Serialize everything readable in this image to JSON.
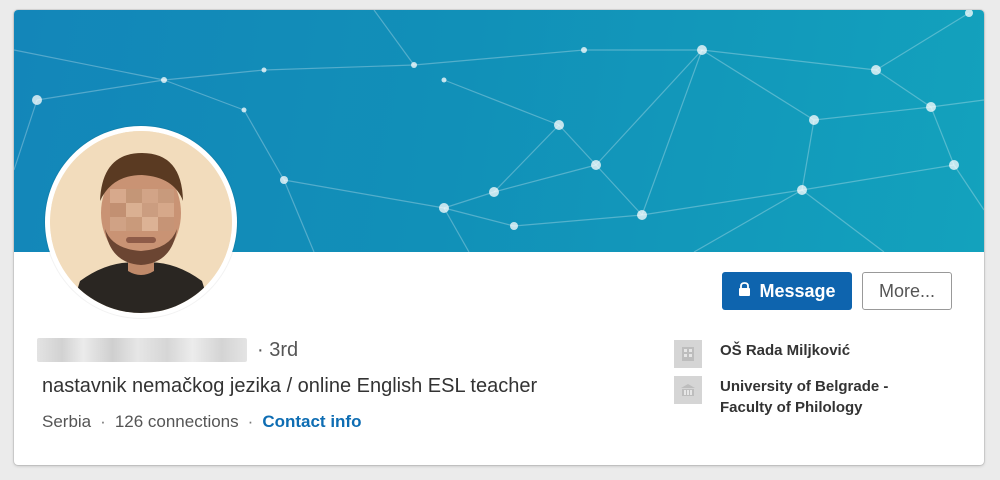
{
  "profile": {
    "degree": "3rd",
    "headline": "nastavnik nemačkog jezika / online English ESL teacher",
    "location": "Serbia",
    "connections": "126 connections",
    "contact_info": "Contact info"
  },
  "actions": {
    "message": "Message",
    "more": "More..."
  },
  "experience": [
    {
      "name": "OŠ Rada Miljković",
      "icon": "building-icon"
    },
    {
      "name_line1": "University of Belgrade -",
      "name_line2": "Faculty of Philology",
      "icon": "school-icon"
    }
  ],
  "colors": {
    "banner": "#1190b8",
    "primary_button": "#0e64ae",
    "link": "#0e6db3"
  }
}
